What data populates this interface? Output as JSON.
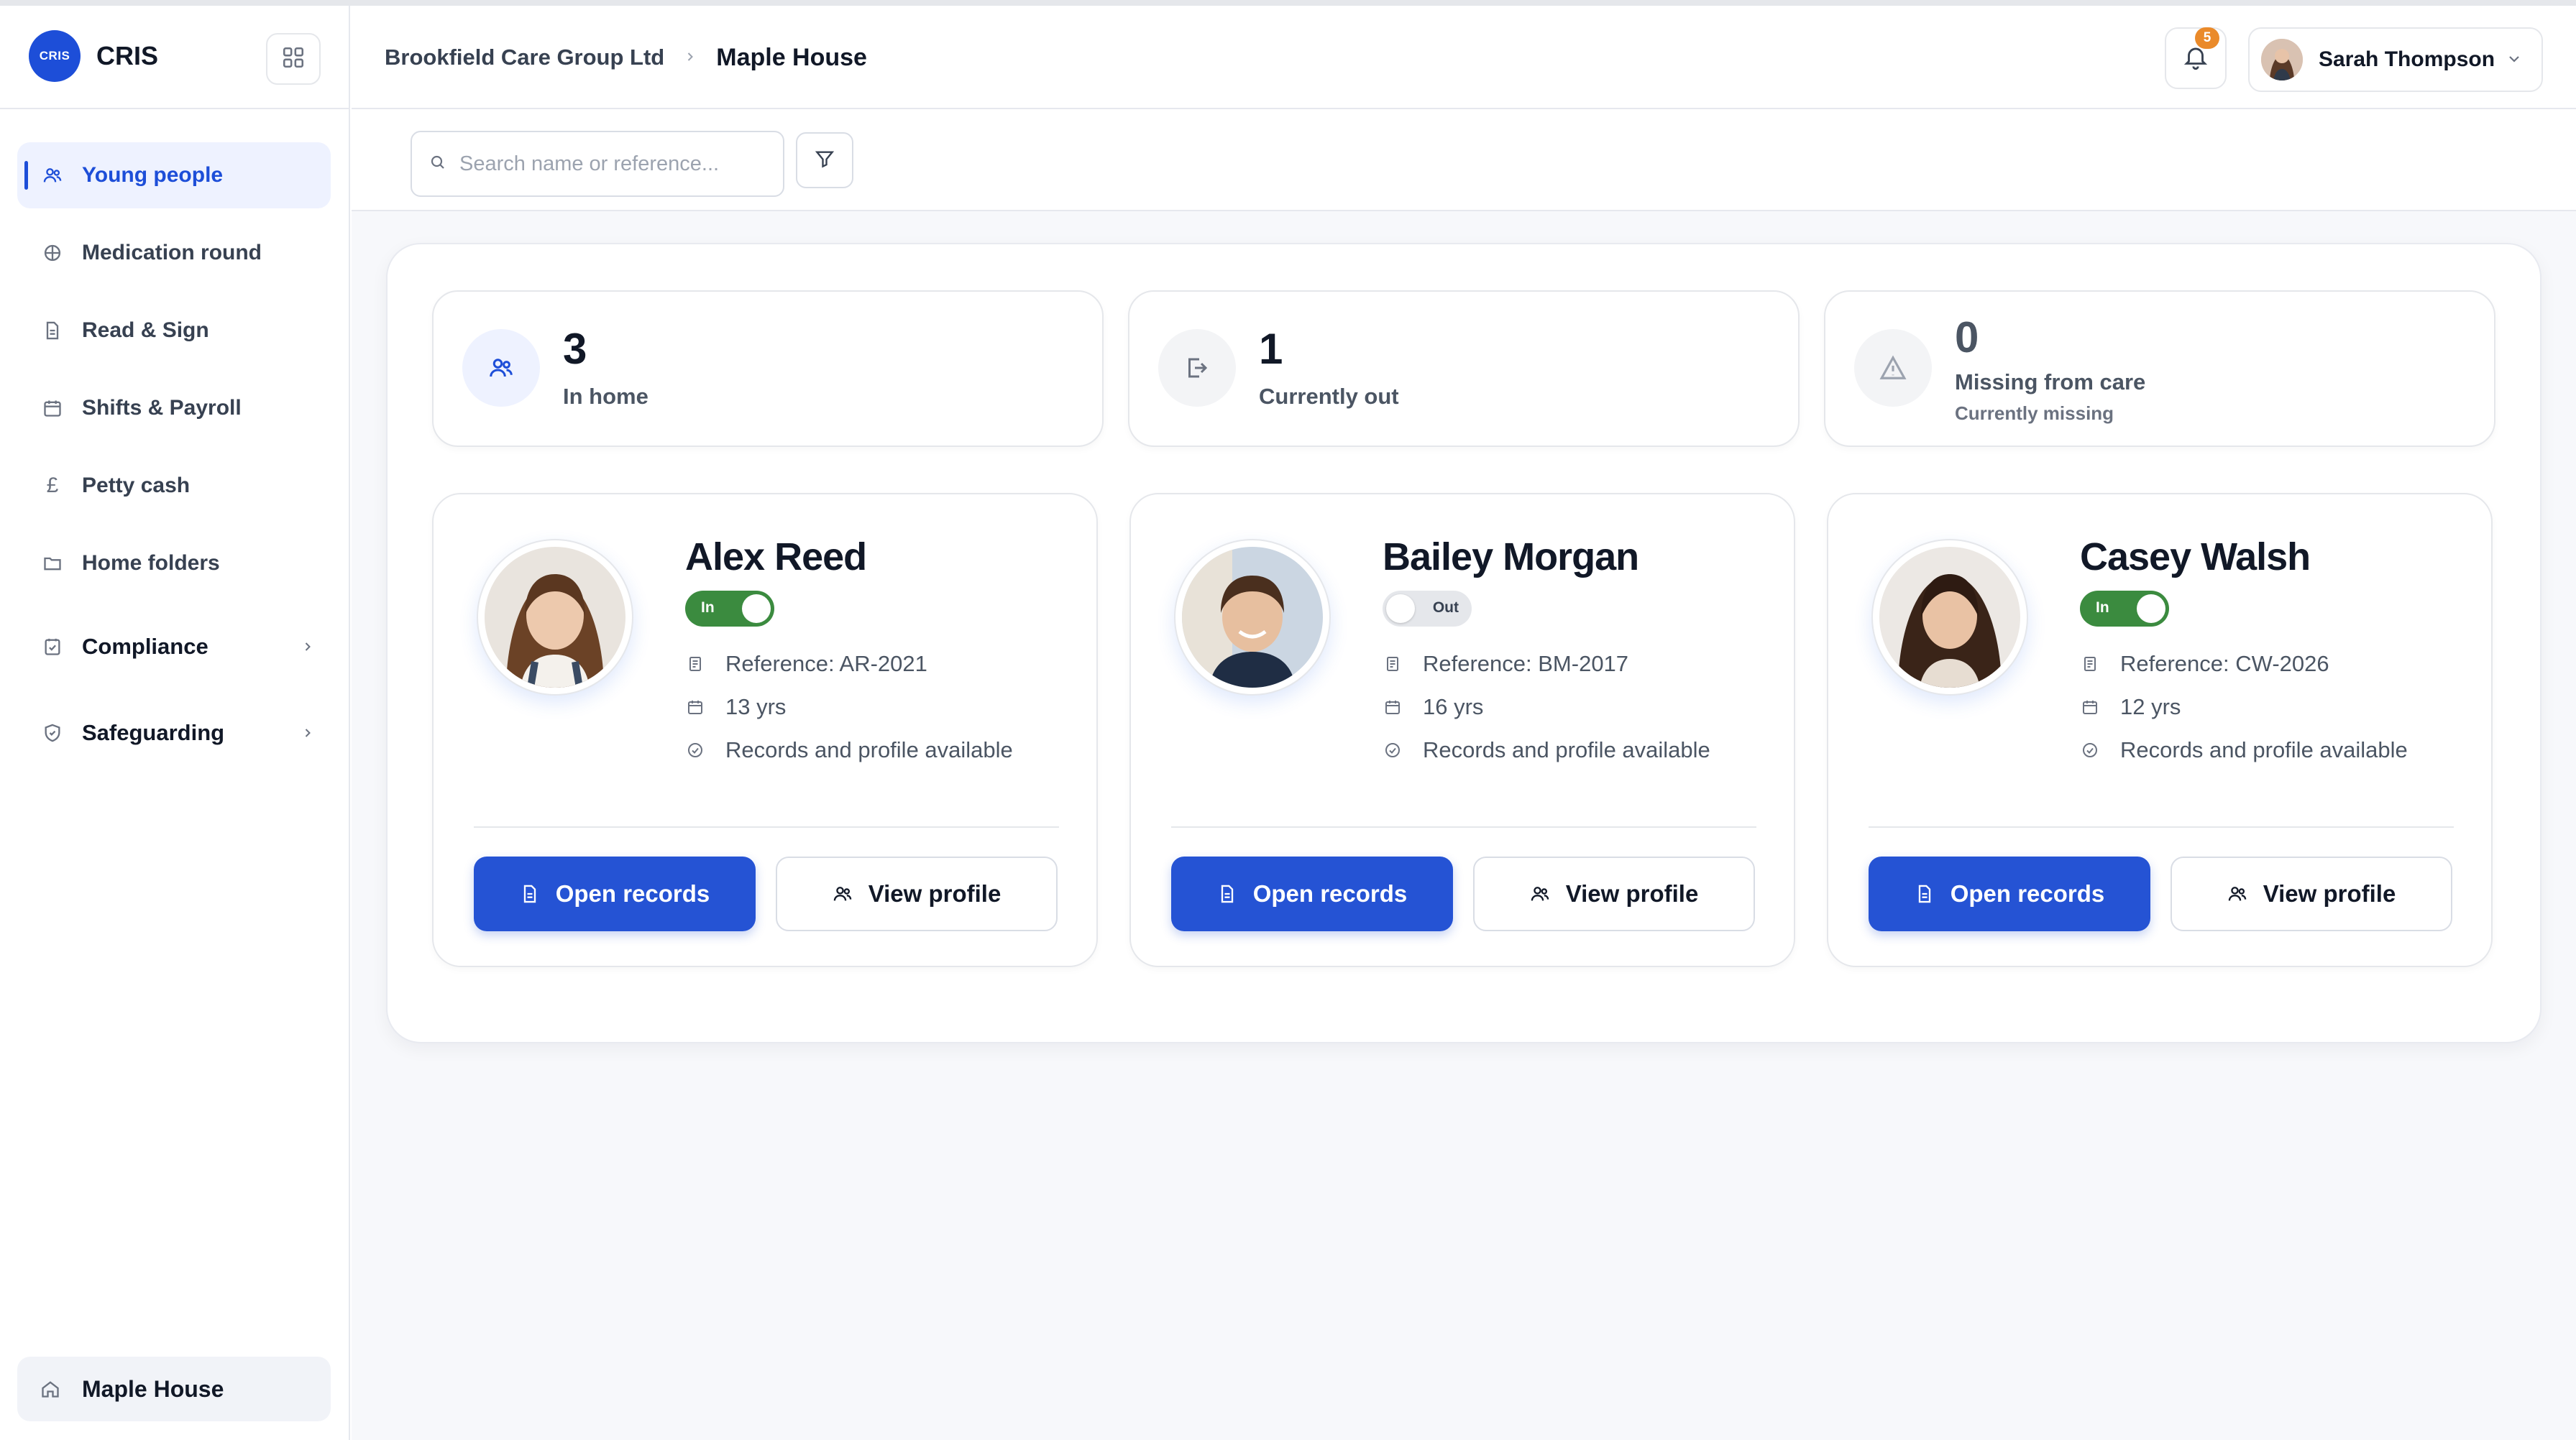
{
  "app": {
    "logo_text": "CRIS",
    "name": "CRIS"
  },
  "sidebar": {
    "items": [
      {
        "label": "Young people",
        "icon": "users-icon",
        "active": true
      },
      {
        "label": "Medication round",
        "icon": "pill-icon"
      },
      {
        "label": "Read & Sign",
        "icon": "document-icon"
      },
      {
        "label": "Shifts & Payroll",
        "icon": "calendar-icon"
      },
      {
        "label": "Petty cash",
        "icon": "pound-icon"
      },
      {
        "label": "Home folders",
        "icon": "folder-icon"
      }
    ],
    "groups": [
      {
        "label": "Compliance",
        "icon": "clipboard-check-icon"
      },
      {
        "label": "Safeguarding",
        "icon": "shield-icon"
      }
    ],
    "home": {
      "label": "Maple House",
      "icon": "home-icon"
    }
  },
  "header": {
    "breadcrumb": {
      "organisation": "Brookfield Care Group Ltd",
      "current": "Maple House"
    },
    "notifications_count": "5",
    "user_name": "Sarah Thompson"
  },
  "toolbar": {
    "search_placeholder": "Search name or reference..."
  },
  "stats": [
    {
      "value": "3",
      "label": "In home",
      "icon": "users-icon"
    },
    {
      "value": "1",
      "label": "Currently out",
      "icon": "sign-out-icon"
    },
    {
      "value": "0",
      "label": "Missing from care",
      "sublabel": "Currently missing",
      "icon": "warning-icon"
    }
  ],
  "people": [
    {
      "name": "Alex Reed",
      "status": "In",
      "reference": "Reference: AR-2021",
      "age": "13 yrs",
      "records": "Records and profile available",
      "open_label": "Open records",
      "profile_label": "View profile"
    },
    {
      "name": "Bailey Morgan",
      "status": "Out",
      "reference": "Reference: BM-2017",
      "age": "16 yrs",
      "records": "Records and profile available",
      "open_label": "Open records",
      "profile_label": "View profile"
    },
    {
      "name": "Casey Walsh",
      "status": "In",
      "reference": "Reference: CW-2026",
      "age": "12 yrs",
      "records": "Records and profile available",
      "open_label": "Open records",
      "profile_label": "View profile"
    }
  ],
  "colors": {
    "accent": "#2553d4",
    "status_in": "#3b8b3f",
    "badge": "#ea8a2a"
  }
}
